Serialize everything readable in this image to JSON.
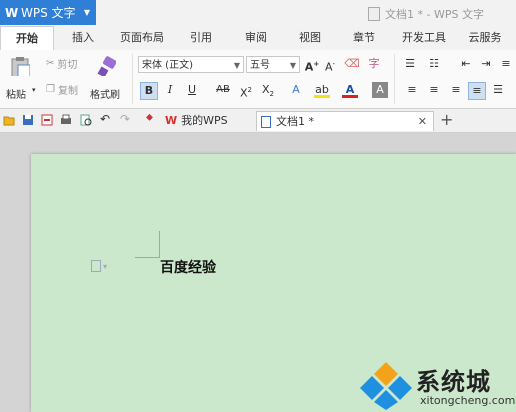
{
  "app": {
    "name": "WPS 文字",
    "window_title": "文档1 * - WPS 文字"
  },
  "menu_tabs": [
    "开始",
    "插入",
    "页面布局",
    "引用",
    "审阅",
    "视图",
    "章节",
    "开发工具",
    "云服务"
  ],
  "active_tab": "开始",
  "ribbon": {
    "paste": "粘贴",
    "cut": "剪切",
    "copy": "复制",
    "format_painter": "格式刷",
    "font_name": "宋体 (正文)",
    "font_size": "五号"
  },
  "doc_tabs": [
    {
      "label": "我的WPS",
      "icon": "wps-logo-icon"
    },
    {
      "label": "文档1 *",
      "icon": "document-icon"
    }
  ],
  "document": {
    "text": "百度经验"
  },
  "watermark": {
    "brand": "系统城",
    "url": "xitongcheng.com"
  },
  "colors": {
    "accent": "#2f7fd7",
    "page_bg": "#cbe8cc",
    "wps_red": "#d9302c"
  }
}
